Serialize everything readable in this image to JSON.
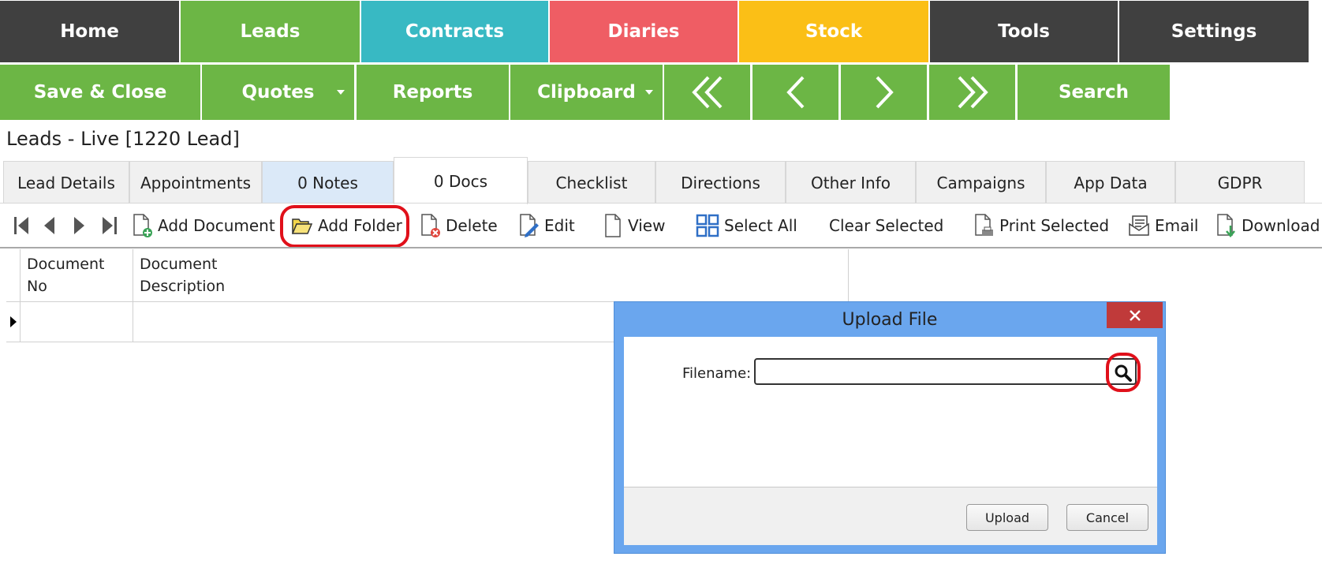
{
  "nav_primary": [
    {
      "label": "Home",
      "color": "#404040"
    },
    {
      "label": "Leads",
      "color": "#6cb645"
    },
    {
      "label": "Contracts",
      "color": "#38b9c3"
    },
    {
      "label": "Diaries",
      "color": "#ef5d64"
    },
    {
      "label": "Stock",
      "color": "#fbbf16"
    },
    {
      "label": "Tools",
      "color": "#404040"
    },
    {
      "label": "Settings",
      "color": "#404040"
    }
  ],
  "nav_secondary": {
    "save_close": "Save & Close",
    "quotes": "Quotes",
    "reports": "Reports",
    "clipboard": "Clipboard",
    "search": "Search",
    "color": "#6cb645"
  },
  "page_title": "Leads - Live [1220  Lead]",
  "tabs": [
    {
      "label": "Lead Details"
    },
    {
      "label": "Appointments"
    },
    {
      "label": "0 Notes"
    },
    {
      "label": "0 Docs"
    },
    {
      "label": "Checklist"
    },
    {
      "label": "Directions"
    },
    {
      "label": "Other Info"
    },
    {
      "label": "Campaigns"
    },
    {
      "label": "App Data"
    },
    {
      "label": "GDPR"
    }
  ],
  "active_tab": "0 Docs",
  "toolbar": {
    "add_document": "Add Document",
    "add_folder": "Add Folder",
    "delete": "Delete",
    "edit": "Edit",
    "view": "View",
    "select_all": "Select All",
    "clear_selected": "Clear Selected",
    "print_selected": "Print Selected",
    "email": "Email",
    "download": "Download"
  },
  "grid": {
    "columns": [
      {
        "line1": "Document",
        "line2": "No"
      },
      {
        "line1": "Document",
        "line2": "Description"
      }
    ],
    "rows": [
      [
        "",
        ""
      ]
    ]
  },
  "dialog": {
    "title": "Upload File",
    "filename_label": "Filename:",
    "filename_value": "",
    "upload_label": "Upload",
    "cancel_label": "Cancel",
    "close_color": "#c03a3a",
    "frame_color": "#6aa6ee"
  },
  "highlight_color": "#e0101a"
}
